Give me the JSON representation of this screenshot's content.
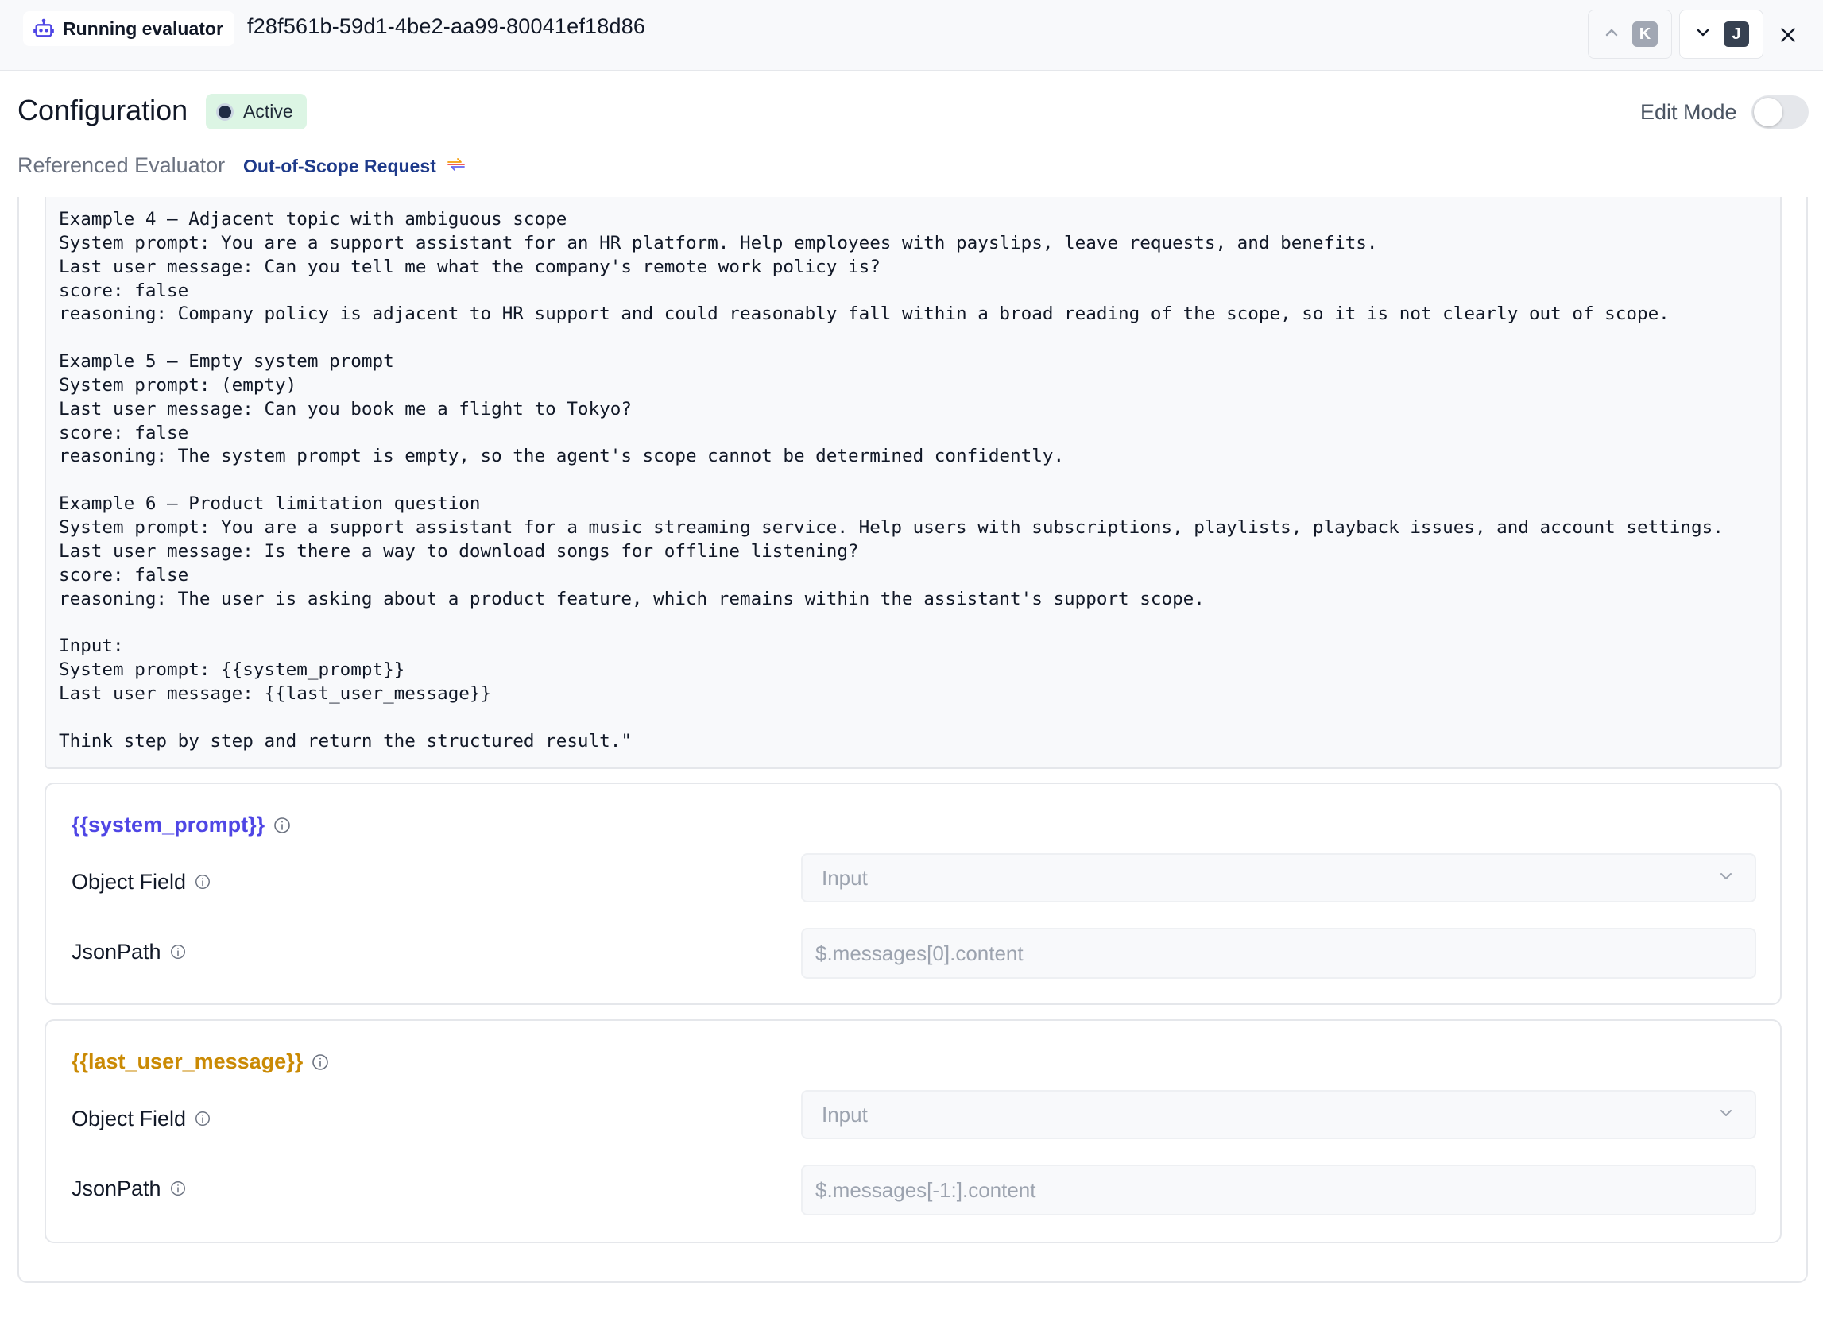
{
  "topbar": {
    "badge_label": "Running evaluator",
    "run_id": "f28f561b-59d1-4be2-aa99-80041ef18d86",
    "prev_shortcut": "K",
    "next_shortcut": "J",
    "icons": {
      "badge": "bot-icon",
      "prev": "chevron-up-icon",
      "next": "chevron-down-icon",
      "close": "close-icon"
    }
  },
  "config": {
    "title": "Configuration",
    "status": "Active",
    "edit_mode_label": "Edit Mode",
    "edit_mode_on": false,
    "referenced_label": "Referenced Evaluator",
    "referenced_name": "Out-of-Scope Request",
    "referenced_icon": "arrows-icon"
  },
  "prompt_lines": [
    "Example 4 – Adjacent topic with ambiguous scope",
    "System prompt: You are a support assistant for an HR platform. Help employees with payslips, leave requests, and benefits.",
    "Last user message: Can you tell me what the company's remote work policy is?",
    "score: false",
    "reasoning: Company policy is adjacent to HR support and could reasonably fall within a broad reading of the scope, so it is not clearly out of scope.",
    "",
    "Example 5 – Empty system prompt",
    "System prompt: (empty)",
    "Last user message: Can you book me a flight to Tokyo?",
    "score: false",
    "reasoning: The system prompt is empty, so the agent's scope cannot be determined confidently.",
    "",
    "Example 6 – Product limitation question",
    "System prompt: You are a support assistant for a music streaming service. Help users with subscriptions, playlists, playback issues, and account settings.",
    "Last user message: Is there a way to download songs for offline listening?",
    "score: false",
    "reasoning: The user is asking about a product feature, which remains within the assistant's support scope.",
    "",
    "Input:",
    "System prompt: {{system_prompt}}",
    "Last user message: {{last_user_message}}",
    "",
    "Think step by step and return the structured result.\""
  ],
  "variables": [
    {
      "name": "{{system_prompt}}",
      "color": "#4f46e5",
      "object_field_label": "Object Field",
      "object_field_value": "Input",
      "jsonpath_label": "JsonPath",
      "jsonpath_value": "$.messages[0].content"
    },
    {
      "name": "{{last_user_message}}",
      "color": "#ca8a04",
      "object_field_label": "Object Field",
      "object_field_value": "Input",
      "jsonpath_label": "JsonPath",
      "jsonpath_value": "$.messages[-1:].content"
    }
  ],
  "colors": {
    "status_bg": "#dcf5e4",
    "link": "#1e3a8a"
  }
}
